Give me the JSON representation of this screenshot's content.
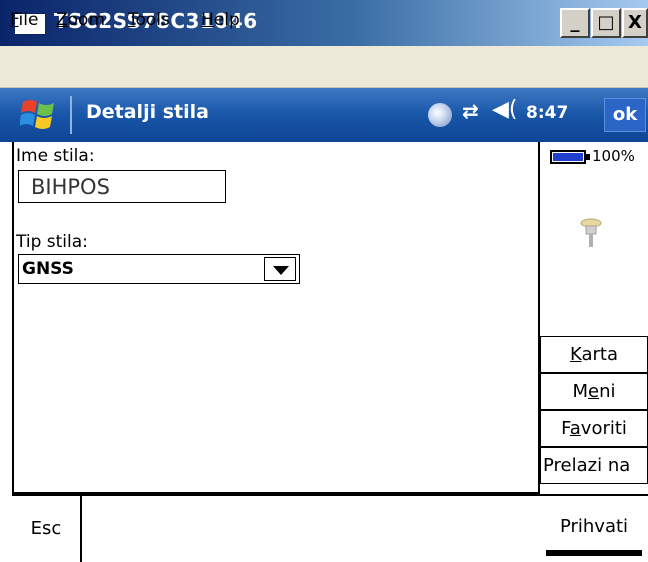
{
  "window": {
    "title": "TSC2SS78C31046",
    "buttons": [
      "_",
      "□",
      "X"
    ]
  },
  "menu": [
    {
      "accel": "F",
      "rest": "ile"
    },
    {
      "accel": "Z",
      "rest": "oom"
    },
    {
      "accel": "T",
      "rest": "ools"
    },
    {
      "accel": "H",
      "rest": "elp"
    }
  ],
  "navbar": {
    "title": "Detalji stila",
    "time": "8:47",
    "ok": "ok"
  },
  "form": {
    "name_label": "Ime stila:",
    "name_value": "BIHPOS",
    "type_label": "Tip stila:",
    "type_value": "GNSS"
  },
  "side": {
    "battery": "100%",
    "buttons": [
      {
        "accel": "K",
        "rest": "arta",
        "pre": ""
      },
      {
        "accel": "e",
        "rest": "ni",
        "pre": "M"
      },
      {
        "accel": "a",
        "rest": "voriti",
        "pre": "F"
      },
      {
        "accel": "",
        "rest": "Prelazi na",
        "pre": ""
      }
    ]
  },
  "bottom": {
    "esc": "Esc",
    "accept": "Prihvati"
  },
  "colors": {
    "title_bar": "#0a246a",
    "nav_bar": "#1856a8",
    "battery_fill": "#1f3fd0"
  }
}
